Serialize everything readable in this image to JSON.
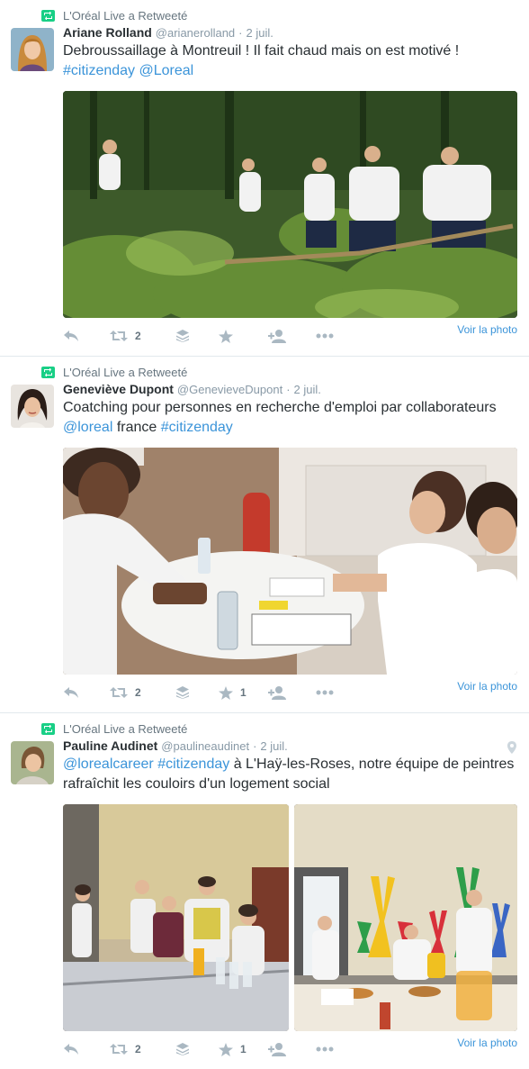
{
  "retweet_label": "L'Oréal Live a Retweeté",
  "voir_photo": "Voir la photo",
  "tweets": [
    {
      "fullname": "Ariane Rolland",
      "username": "@arianerolland",
      "separator": "·",
      "time": "2 juil.",
      "text_plain": "Debroussaillage à Montreuil ! Il fait chaud mais on est motivé !",
      "hashtag": "#citizenday",
      "mention": "@Loreal",
      "retweet_count": "2",
      "favorite_count": ""
    },
    {
      "fullname": "Geneviève Dupont",
      "username": "@GenevieveDupont",
      "separator": "·",
      "time": "2 juil.",
      "text_plain": "Coatching pour personnes en recherche d'emploi par collaborateurs",
      "mention": "@loreal",
      "text_mid": "france",
      "hashtag": "#citizenday",
      "retweet_count": "2",
      "favorite_count": "1"
    },
    {
      "fullname": "Pauline Audinet",
      "username": "@paulineaudinet",
      "separator": "·",
      "time": "2 juil.",
      "mention": "@lorealcareer",
      "hashtag": "#citizenday",
      "text_line1_rest": "à L'Haÿ-les-Roses, notre équipe de peintres",
      "text_line2": "rafraîchit les couloirs d'un logement social",
      "retweet_count": "2",
      "favorite_count": "1"
    }
  ],
  "colors": {
    "link": "#3b94d9",
    "retweet_green": "#19cf86",
    "muted": "#8899a6",
    "icon_grey": "#aab8c2"
  }
}
